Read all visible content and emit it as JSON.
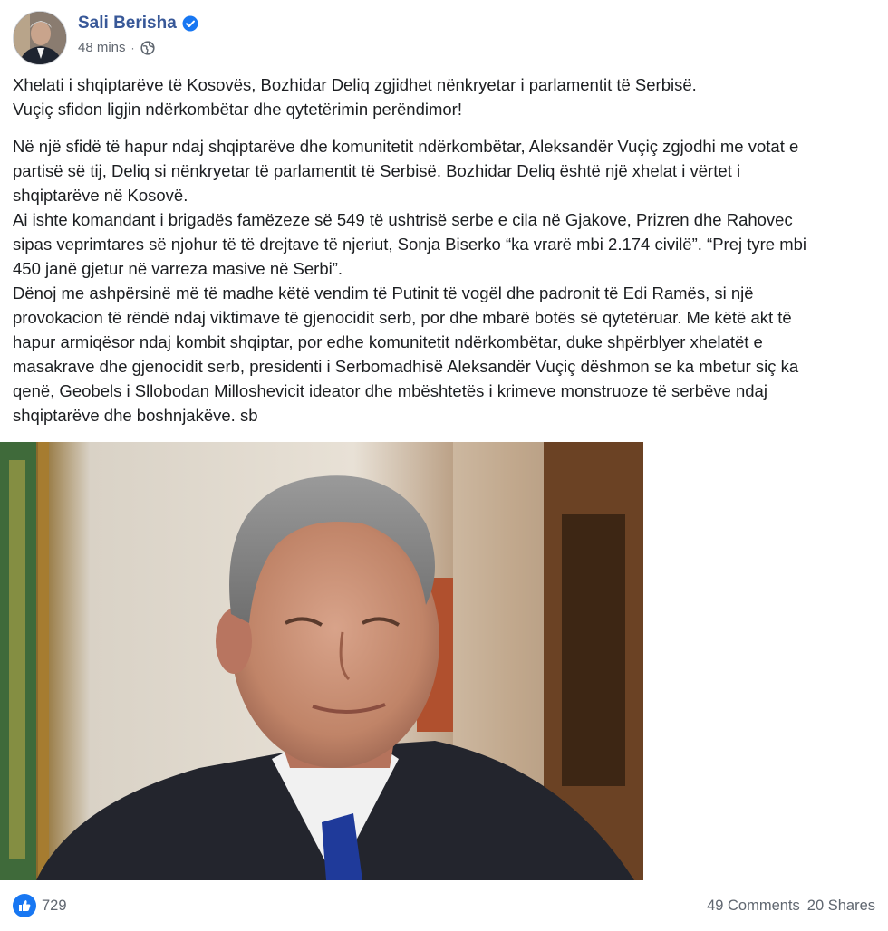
{
  "post": {
    "author": "Sali Berisha",
    "verified_icon": "verified-badge-icon",
    "timestamp": "48 mins",
    "separator": "·",
    "audience_icon": "globe-icon",
    "headline_lines": [
      "Xhelati i shqiptarëve të Kosovës, Bozhidar Deliq zgjidhet nënkryetar i parlamentit të Serbisë.",
      "Vuçiç sfidon ligjin ndërkombëtar dhe qytetërimin perëndimor!"
    ],
    "body_lines": [
      "Në një sfidë të hapur ndaj shqiptarëve dhe komunitetit ndërkombëtar, Aleksandër Vuçiç zgjodhi me votat e",
      "partisë së tij, Deliq si nënkryetar të parlamentit të Serbisë. Bozhidar Deliq është një xhelat i vërtet i",
      "shqiptarëve në Kosovë.",
      "Ai ishte komandant i brigadës famëzeze së 549 të ushtrisë serbe e cila në Gjakove, Prizren dhe Rahovec",
      "sipas veprimtares së njohur të të drejtave të njeriut, Sonja Biserko “ka vrarë mbi 2.174 civilë”. “Prej tyre mbi",
      "450 janë gjetur në varreza masive në Serbi”.",
      "Dënoj me ashpërsinë më të madhe këtë vendim të Putinit të vogël dhe padronit të Edi Ramës, si një",
      "provokacion të rëndë ndaj viktimave të gjenocidit serb, por dhe mbarë botës së qytetëruar. Me këtë akt të",
      "hapur armiqësor ndaj kombit shqiptar, por edhe komunitetit ndërkombëtar, duke shpërblyer xhelatët e",
      "masakrave dhe gjenocidit serb, presidenti i Serbomadhisë Aleksandër Vuçiç dëshmon se ka mbetur siç ka",
      "qenë, Geobels i Sllobodan Milloshevicit ideator dhe mbështetës i krimeve monstruoze të serbëve ndaj",
      "shqiptarëve dhe boshnjakëve. sb"
    ]
  },
  "footer": {
    "like_icon": "thumbs-up-icon",
    "like_count": "729",
    "comments": "49 Comments",
    "shares": "20 Shares"
  },
  "colors": {
    "author": "#385898",
    "like_blue": "#1877f2",
    "muted": "#606770"
  }
}
